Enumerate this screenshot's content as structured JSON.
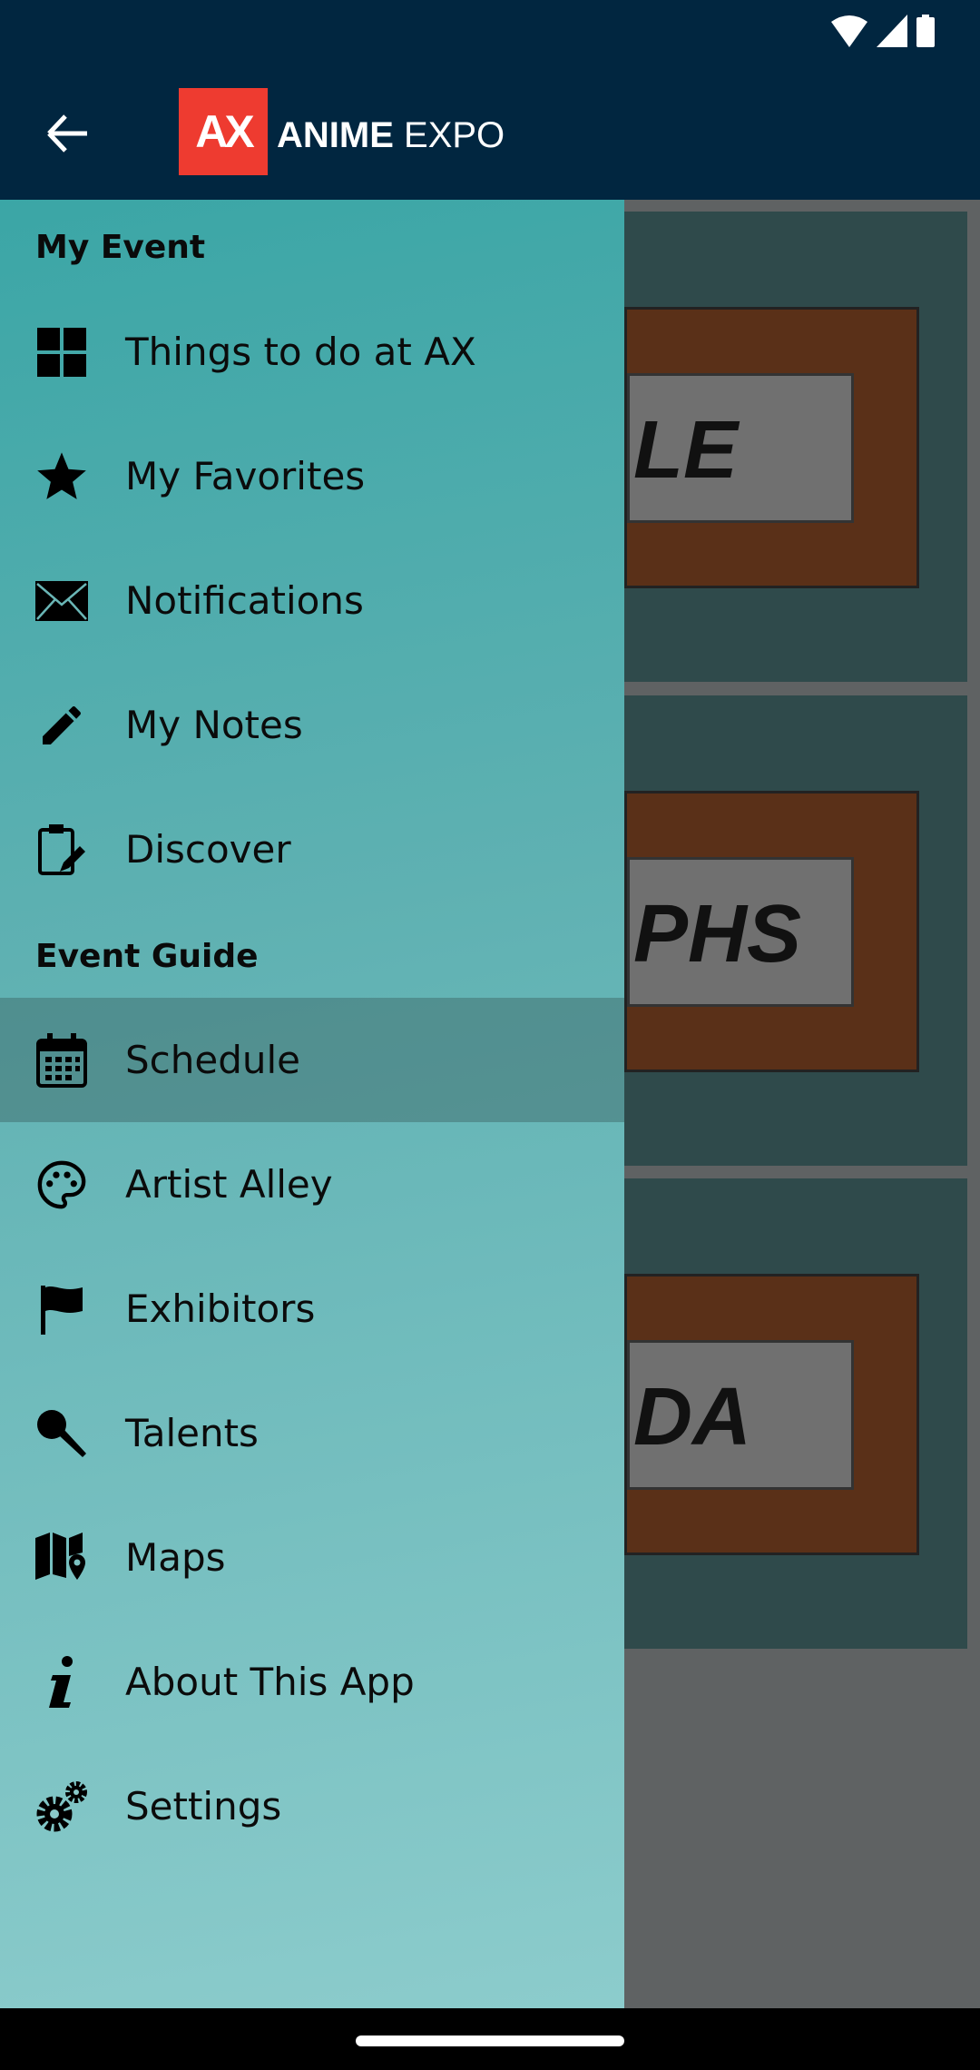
{
  "status_bar": {
    "icons": [
      "wifi-icon",
      "signal-icon",
      "battery-icon"
    ]
  },
  "app_bar": {
    "back_icon": "arrow-left-icon",
    "logo_mark": "AX",
    "logo_text_bold": "ANIME",
    "logo_text": "EXPO",
    "colors": {
      "bar": "#012640",
      "logo_red": "#ee3b30"
    }
  },
  "background_cards": [
    {
      "text": "LE"
    },
    {
      "text": "PHS"
    },
    {
      "text": "DA"
    }
  ],
  "drawer": {
    "sections": [
      {
        "title": "My Event",
        "items": [
          {
            "label": "Things to do at AX",
            "icon": "grid-icon"
          },
          {
            "label": "My Favorites",
            "icon": "star-icon"
          },
          {
            "label": "Notifications",
            "icon": "envelope-icon"
          },
          {
            "label": "My Notes",
            "icon": "pencil-icon"
          },
          {
            "label": "Discover",
            "icon": "clipboard-edit-icon"
          }
        ]
      },
      {
        "title": "Event Guide",
        "items": [
          {
            "label": "Schedule",
            "icon": "calendar-icon",
            "selected": true
          },
          {
            "label": "Artist Alley",
            "icon": "palette-icon"
          },
          {
            "label": "Exhibitors",
            "icon": "flag-icon"
          },
          {
            "label": "Talents",
            "icon": "microphone-icon"
          },
          {
            "label": "Maps",
            "icon": "map-pin-icon"
          },
          {
            "label": "About This App",
            "icon": "info-icon"
          },
          {
            "label": "Settings",
            "icon": "gears-icon"
          }
        ]
      }
    ]
  }
}
